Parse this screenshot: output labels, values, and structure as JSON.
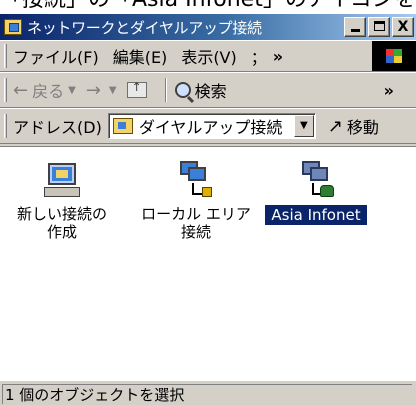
{
  "caption": "「接続」の「Asia Infonet」のアイコンをクリック",
  "window": {
    "title": "ネットワークとダイヤルアップ接続",
    "buttons": {
      "minimize": "_",
      "maximize": "□",
      "close": "X"
    }
  },
  "menubar": {
    "items": [
      "ファイル(F)",
      "編集(E)",
      "表示(V)",
      "；"
    ],
    "more": "»"
  },
  "toolbar": {
    "back_label": "戻る",
    "search_label": "検索",
    "more": "»"
  },
  "addressbar": {
    "label": "アドレス(D)",
    "value": "ダイヤルアップ接続",
    "go_label": "移動"
  },
  "items": [
    {
      "label": "新しい接続の\n作成",
      "icon": "new-connection-wizard-icon",
      "selected": false
    },
    {
      "label": "ローカル エリア\n接続",
      "icon": "lan-connection-icon",
      "selected": false
    },
    {
      "label": "Asia Infonet",
      "icon": "dialup-connection-icon",
      "selected": true
    }
  ],
  "status": {
    "text": "1 個のオブジェクトを選択"
  },
  "colors": {
    "titlebar_start": "#0a246a",
    "titlebar_end": "#a6caf0",
    "selection": "#0a246a",
    "face": "#d4d0c8"
  }
}
